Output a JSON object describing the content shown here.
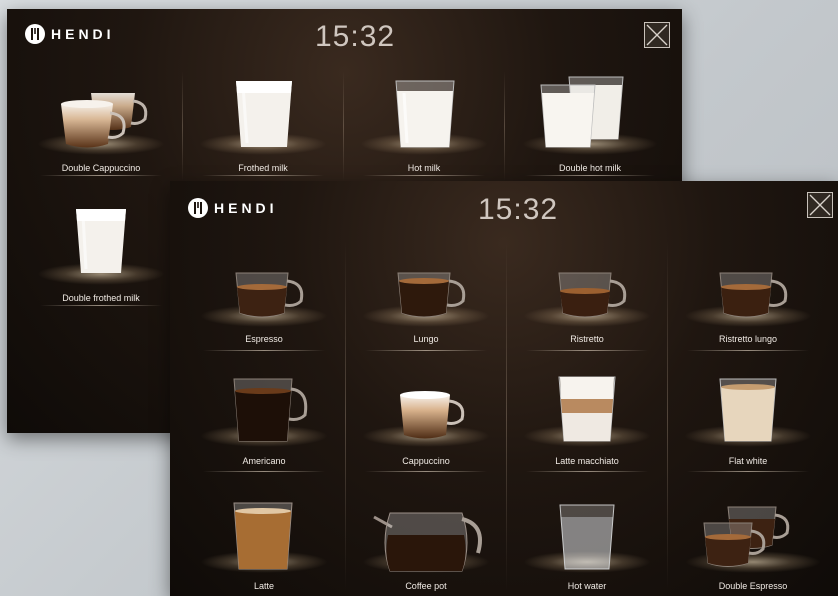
{
  "back_screen": {
    "brand": "HENDI",
    "time": "15:32",
    "items": [
      {
        "label": "Double Cappuccino"
      },
      {
        "label": "Frothed milk"
      },
      {
        "label": "Hot milk"
      },
      {
        "label": "Double hot milk"
      },
      {
        "label": "Double frothed milk"
      }
    ]
  },
  "front_screen": {
    "brand": "HENDI",
    "time": "15:32",
    "items": [
      {
        "label": "Espresso"
      },
      {
        "label": "Lungo"
      },
      {
        "label": "Ristretto"
      },
      {
        "label": "Ristretto lungo"
      },
      {
        "label": "Americano"
      },
      {
        "label": "Cappuccino"
      },
      {
        "label": "Latte macchiato"
      },
      {
        "label": "Flat white"
      },
      {
        "label": "Latte"
      },
      {
        "label": "Coffee pot"
      },
      {
        "label": "Hot water"
      },
      {
        "label": "Double Espresso"
      }
    ]
  },
  "icons": {
    "close": "close-icon",
    "logo": "cutlery-logo-icon"
  },
  "colors": {
    "screen_background": "#1f1610",
    "text": "#f1ebe5",
    "clock": "#cfc6bf"
  }
}
